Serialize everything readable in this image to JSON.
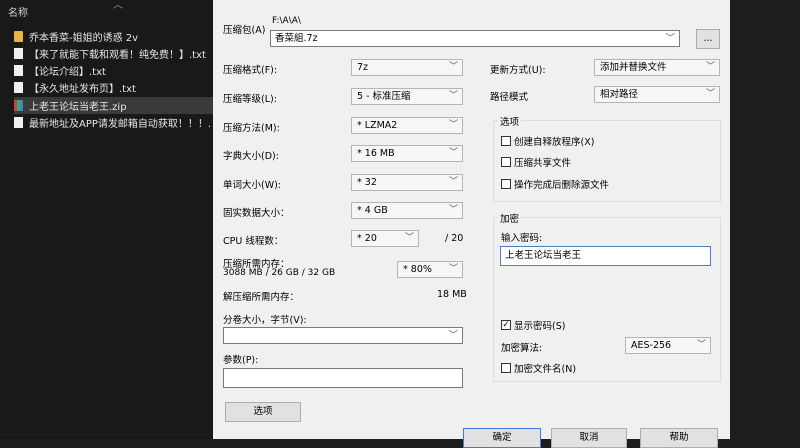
{
  "explorer": {
    "header": "名称",
    "files": [
      {
        "name": "乔本香菜-姐姐的诱惑 2v",
        "type": "folder"
      },
      {
        "name": "【来了就能下载和观看！纯免费！】.txt",
        "type": "doc"
      },
      {
        "name": "【论坛介绍】.txt",
        "type": "doc"
      },
      {
        "name": "【永久地址发布页】.txt",
        "type": "doc"
      },
      {
        "name": "上老王论坛当老王.zip",
        "type": "zip"
      },
      {
        "name": "最新地址及APP请发邮箱自动获取！！！.",
        "type": "doc"
      }
    ]
  },
  "dialog": {
    "archive_label": "压缩包(A)",
    "archive_path": "F:\\A\\A\\",
    "archive_name": "香菜組.7z",
    "browse_label": "...",
    "format_label": "压缩格式(F):",
    "format_value": "7z",
    "level_label": "压缩等级(L):",
    "level_value": "5 - 标准压缩",
    "method_label": "压缩方法(M):",
    "method_value": "* LZMA2",
    "dict_label": "字典大小(D):",
    "dict_value": "* 16 MB",
    "word_label": "单词大小(W):",
    "word_value": "* 32",
    "solid_label": "固实数据大小：",
    "solid_value": "* 4 GB",
    "cpu_label": "CPU 线程数：",
    "cpu_value": "* 20",
    "cpu_total": "/ 20",
    "mem_label": "压缩所需内存：",
    "mem_detail": "3088 MB / 26 GB / 32 GB",
    "mem_value": "* 80%",
    "decomp_label": "解压缩所需内存：",
    "decomp_value": "18 MB",
    "split_label": "分卷大小，字节(V):",
    "split_value": "",
    "params_label": "参数(P):",
    "params_value": "",
    "options_button": "选项",
    "update_label": "更新方式(U):",
    "update_value": "添加并替换文件",
    "path_label": "路径模式",
    "path_value": "相对路径",
    "options_group": "选项",
    "opt_sfx": "创建自释放程序(X)",
    "opt_shared": "压缩共享文件",
    "opt_delete": "操作完成后删除源文件",
    "enc_group": "加密",
    "enc_pwd_label": "输入密码:",
    "enc_pwd_value": "上老王论坛当老王",
    "show_pwd": "显示密码(S)",
    "enc_method_label": "加密算法:",
    "enc_method_value": "AES-256",
    "enc_names": "加密文件名(N)",
    "ok": "确定",
    "cancel": "取消",
    "help": "帮助"
  }
}
